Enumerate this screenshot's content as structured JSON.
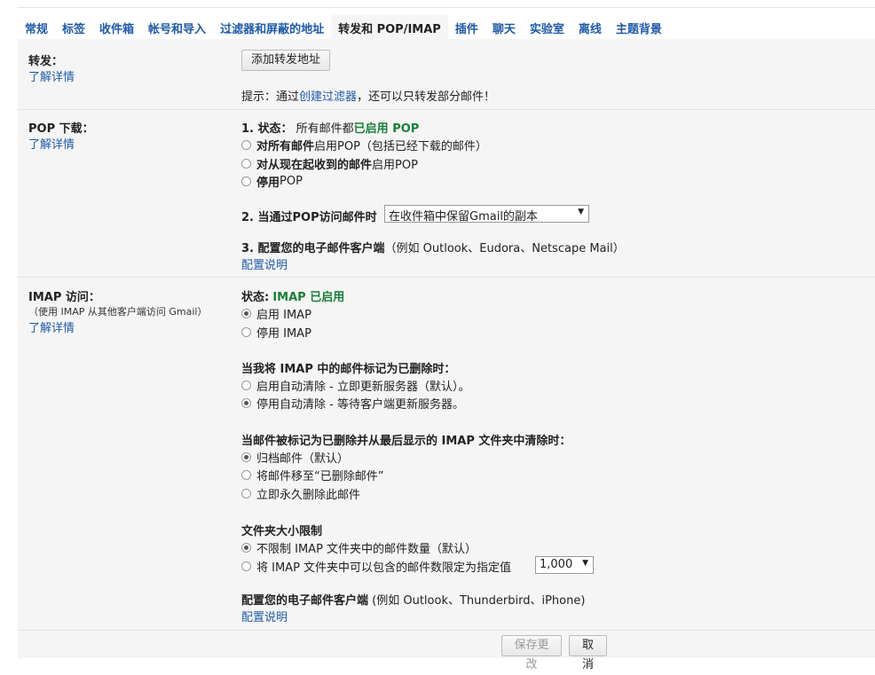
{
  "tabs": [
    "常规",
    "标签",
    "收件箱",
    "帐号和导入",
    "过滤器和屏蔽的地址",
    "转发和 POP/IMAP",
    "插件",
    "聊天",
    "实验室",
    "离线",
    "主题背景"
  ],
  "forwarding": {
    "label": "转发：",
    "learn_more": "了解详情",
    "add_button": "添加转发地址",
    "tip_prefix": "提示：通过",
    "tip_link": "创建过滤器",
    "tip_suffix": "，还可以只转发部分邮件！"
  },
  "pop": {
    "label": "POP 下载：",
    "learn_more": "了解详情",
    "status_prefix": "1. 状态：",
    "status_text": "所有邮件都",
    "status_value": "已启用 POP",
    "option1_bold": "对所有邮件",
    "option1_rest": "启用POP（包括已经下载的邮件）",
    "option2_bold": "对从现在起收到的邮件",
    "option2_rest": "启用POP",
    "option3_bold": "停用",
    "option3_rest": "POP",
    "when_label": "2. 当通过POP访问邮件时",
    "when_select": "在收件箱中保留Gmail的副本",
    "configure_label": "3. 配置您的电子邮件客户端",
    "configure_hint": "（例如 Outlook、Eudora、Netscape Mail）",
    "configure_link": "配置说明"
  },
  "imap": {
    "label": "IMAP 访问：",
    "sublabel": "（使用 IMAP 从其他客户端访问 Gmail）",
    "learn_more": "了解详情",
    "status_label": "状态:",
    "status_value": "IMAP 已启用",
    "enable": "启用 IMAP",
    "disable": "停用 IMAP",
    "deleted_heading": "当我将 IMAP 中的邮件标记为已删除时：",
    "expunge_on": "启用自动清除 - 立即更新服务器（默认）。",
    "expunge_off": "停用自动清除 - 等待客户端更新服务器。",
    "expunged_heading": "当邮件被标记为已删除并从最后显示的 IMAP 文件夹中清除时：",
    "archive": "归档邮件（默认）",
    "trash": "将邮件移至“已删除邮件”",
    "delete_forever": "立即永久删除此邮件",
    "folder_heading": "文件夹大小限制",
    "no_limit": "不限制 IMAP 文件夹中的邮件数量（默认）",
    "limit": "将 IMAP 文件夹中可以包含的邮件数限定为指定值",
    "limit_select": "1,000",
    "configure_label": "配置您的电子邮件客户端",
    "configure_hint": "(例如 Outlook、Thunderbird、iPhone)",
    "configure_link": "配置说明"
  },
  "footer": {
    "save": "保存更改",
    "cancel": "取消"
  }
}
